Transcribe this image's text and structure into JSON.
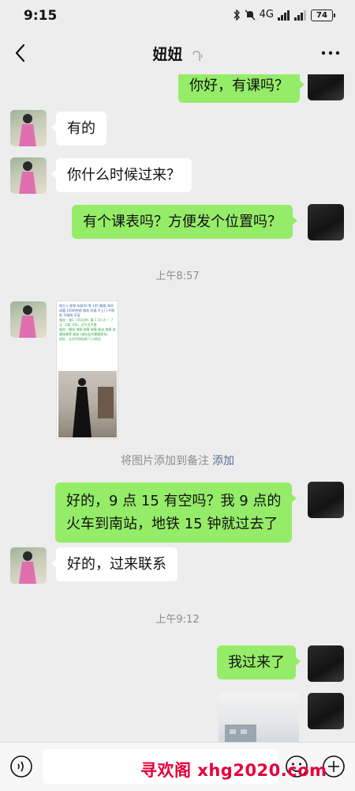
{
  "status_bar": {
    "time": "9:15",
    "network": "4G",
    "battery": "74"
  },
  "nav": {
    "title": "妞妞"
  },
  "messages": [
    {
      "side": "out",
      "text": "你好，有课吗？"
    },
    {
      "side": "in",
      "text": "有的"
    },
    {
      "side": "in",
      "text": "你什么时候过来？"
    },
    {
      "side": "out",
      "text": "有个课表吗？方便发个位置吗？"
    },
    {
      "side": "out",
      "text": "好的，9 点 15 有空吗？我 9 点的"
    },
    {
      "side": "out",
      "text": "火车到南站，地铁 15 钟就过去了"
    },
    {
      "side": "in",
      "text": "好的，过来联系"
    },
    {
      "side": "out",
      "text": "我过来了"
    }
  ],
  "timestamps": [
    "上午8:57",
    "上午9:12"
  ],
  "image_note": {
    "text": "将图片添加到备注",
    "link": "添加"
  },
  "image_doc": {
    "line1": "南方人 昵称 年龄30 等 145 胸围 36D 体重 100的性格 服务 好骚 不上门 不侧脸 不接吻 不深",
    "line2": "服务：课1（45分钟）服 1 10 点 — 7 点（2套 100，过午点不提",
    "line3": "服务：桶场 泡脚 按摩 按摩 推油 按摩 按摩按摩等 服务 (请在此时需要联系)",
    "line4": "地址：五台环保局前 5 口附近"
  },
  "watermark": "寻欢阁 xhg2020.com",
  "colors": {
    "background": "#ededed",
    "bubble_out": "#95ec69",
    "bubble_in": "#ffffff",
    "link": "#576b95",
    "watermark": "#e5003a"
  },
  "icons": {
    "back": "chevron-left-icon",
    "voice_badge": "sound-icon",
    "more": "more-icon",
    "voice_input": "voice-icon",
    "emoji": "emoji-icon",
    "plus": "plus-icon"
  }
}
